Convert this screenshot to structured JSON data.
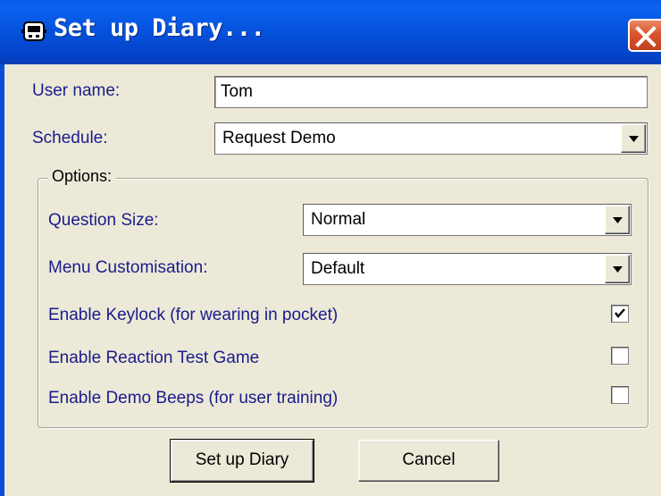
{
  "window": {
    "title": "Set up Diary...",
    "icons": {
      "app": "diary-device-icon",
      "close": "close-icon"
    },
    "colors": {
      "titlebar": "#0553dd",
      "close": "#d8542d",
      "face": "#ece9d8",
      "label": "#1a1c8c"
    }
  },
  "form": {
    "user_name_label": "User name:",
    "user_name_value": "Tom",
    "schedule_label": "Schedule:",
    "schedule_value": "Request Demo"
  },
  "options": {
    "legend": "Options:",
    "question_size_label": "Question Size:",
    "question_size_value": "Normal",
    "menu_label": "Menu Customisation:",
    "menu_value": "Default",
    "checkboxes": [
      {
        "label": "Enable Keylock (for wearing in pocket)",
        "checked": true
      },
      {
        "label": "Enable Reaction Test Game",
        "checked": false
      },
      {
        "label": "Enable Demo Beeps (for user training)",
        "checked": false
      }
    ]
  },
  "buttons": {
    "setup_label": "Set up Diary",
    "cancel_label": "Cancel"
  }
}
